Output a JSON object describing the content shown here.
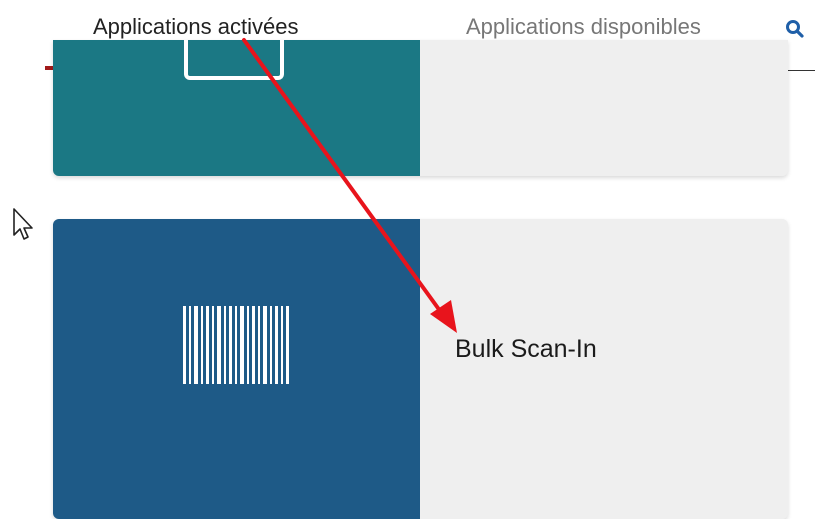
{
  "tabs": {
    "active_label": "Applications activées",
    "inactive_label": "Applications disponibles"
  },
  "search": {
    "icon": "search-icon"
  },
  "cards": [
    {
      "thumb_color": "#1b7884",
      "icon": "app-icon"
    },
    {
      "thumb_color": "#1e5a87",
      "icon": "barcode-icon",
      "name": "Bulk Scan-In"
    }
  ],
  "annotation": {
    "arrow_color": "#e8141c"
  },
  "cursor": {
    "icon": "cursor-arrow-icon"
  }
}
